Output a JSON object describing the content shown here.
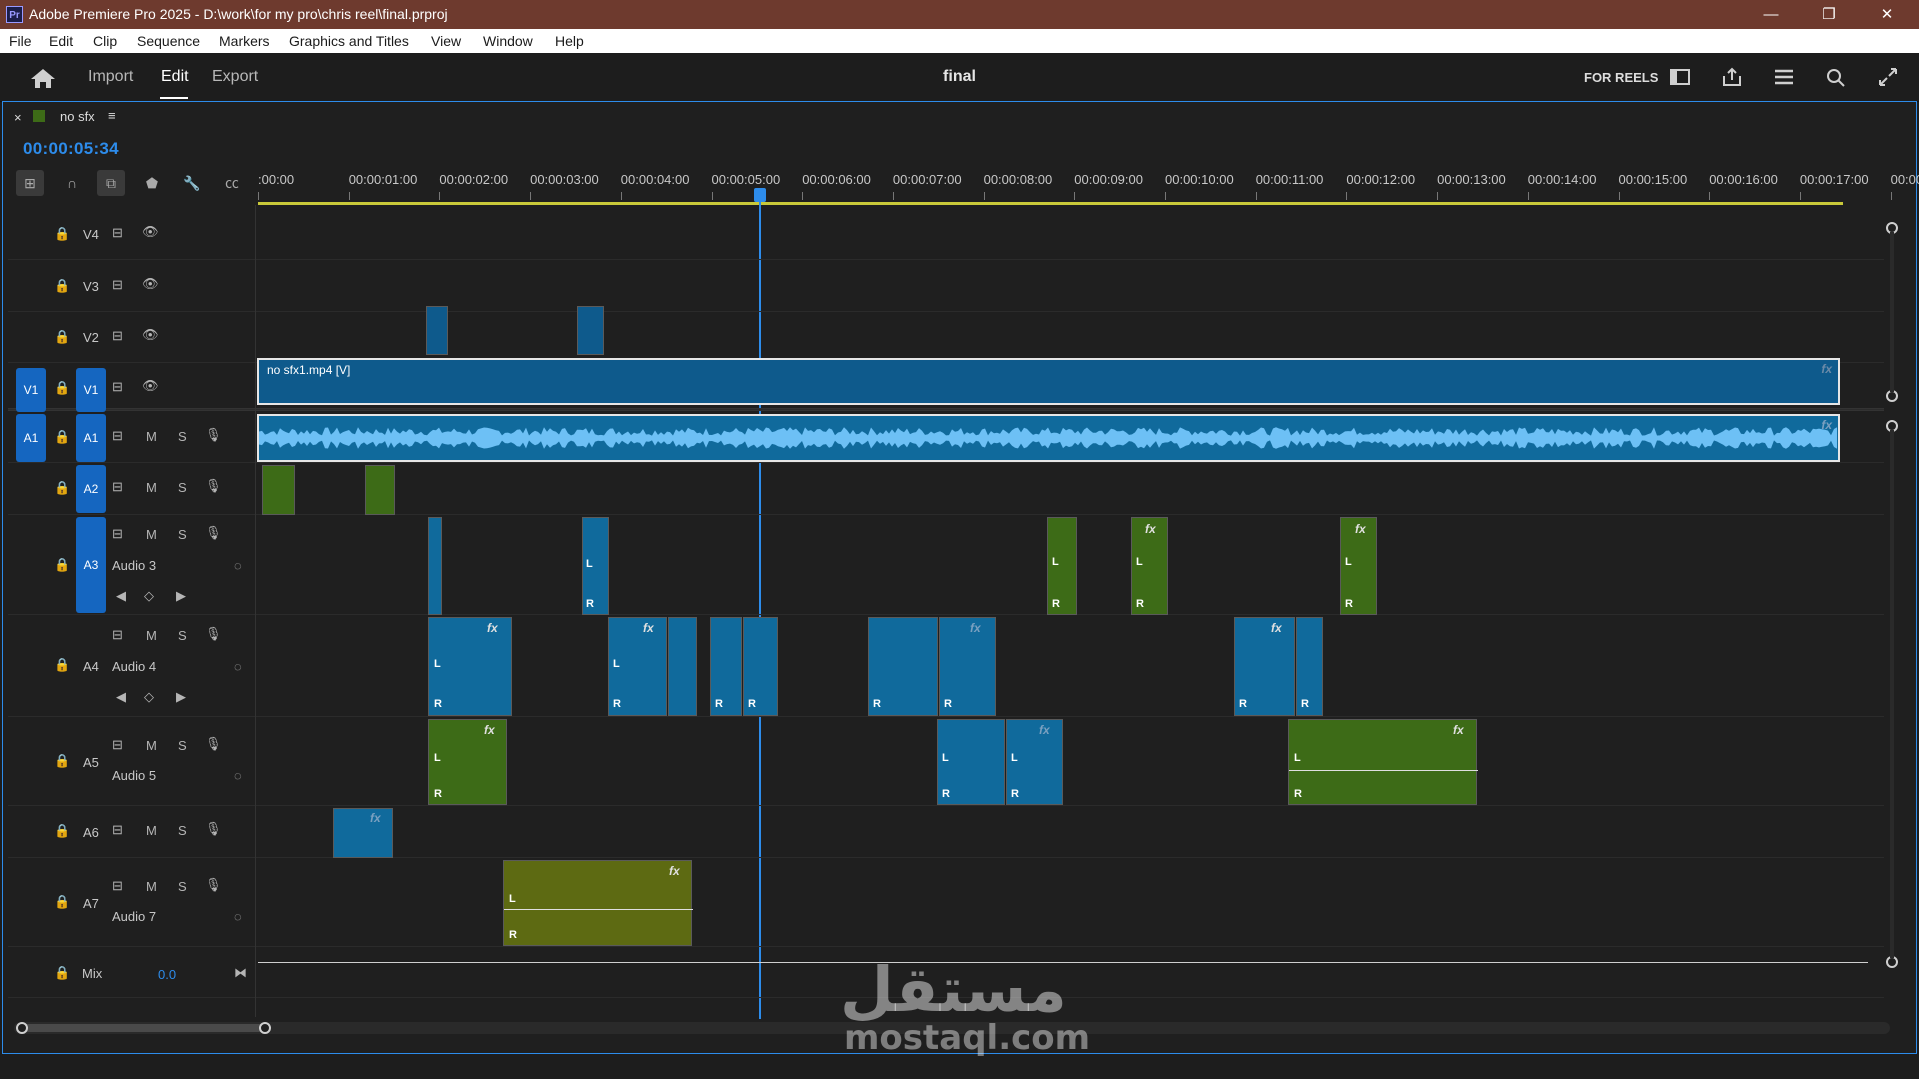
{
  "window": {
    "title": "Adobe Premiere Pro 2025 - D:\\work\\for my pro\\chris reel\\final.prproj",
    "app_icon": "Pr",
    "minimize": "—",
    "restore": "❐",
    "close": "✕"
  },
  "menu": [
    "File",
    "Edit",
    "Clip",
    "Sequence",
    "Markers",
    "Graphics and Titles",
    "View",
    "Window",
    "Help"
  ],
  "header": {
    "tabs": [
      "Import",
      "Edit",
      "Export"
    ],
    "active_tab": "Edit",
    "sequence_name": "final",
    "workspace_label": "FOR REELS"
  },
  "panel": {
    "close": "×",
    "sequence_tab": "no sfx",
    "menu_glyph": "≡",
    "timecode": "00:00:05:34"
  },
  "ruler": {
    "labels": [
      ":00:00",
      "00:00:01:00",
      "00:00:02:00",
      "00:00:03:00",
      "00:00:04:00",
      "00:00:05:00",
      "00:00:06:00",
      "00:00:07:00",
      "00:00:08:00",
      "00:00:09:00",
      "00:00:10:00",
      "00:00:11:00",
      "00:00:12:00",
      "00:00:13:00",
      "00:00:14:00",
      "00:00:15:00",
      "00:00:16:00",
      "00:00:17:00",
      "00:00:"
    ]
  },
  "tracks": {
    "video": [
      {
        "id": "V4",
        "source": ""
      },
      {
        "id": "V3",
        "source": ""
      },
      {
        "id": "V2",
        "source": ""
      },
      {
        "id": "V1",
        "source": "V1"
      }
    ],
    "audio": [
      {
        "id": "A1",
        "source": "A1",
        "name": ""
      },
      {
        "id": "A2",
        "source": "",
        "name": ""
      },
      {
        "id": "A3",
        "source": "",
        "name": "Audio 3"
      },
      {
        "id": "A4",
        "source": "",
        "name": "Audio 4"
      },
      {
        "id": "A5",
        "source": "",
        "name": "Audio 5"
      },
      {
        "id": "A6",
        "source": "",
        "name": ""
      },
      {
        "id": "A7",
        "source": "",
        "name": "Audio 7"
      }
    ],
    "mix": {
      "label": "Mix",
      "value": "0.0"
    },
    "mute_label": "M",
    "solo_label": "S"
  },
  "clips": {
    "v1_clip_name": "no sfx1.mp4 [V]",
    "fx_label": "fx",
    "left_channel": "L",
    "right_channel": "R"
  },
  "colors": {
    "accent": "#2d8ceb",
    "video_clip": "#0e5a8c",
    "audio_clip": "#106a9c",
    "audio_clip_green": "#3d6b17",
    "audio_clip_olive": "#5d6a12",
    "titlebar": "#6e3a2e"
  },
  "watermark": {
    "arabic": "مستقل",
    "latin": "mostaql.com"
  }
}
